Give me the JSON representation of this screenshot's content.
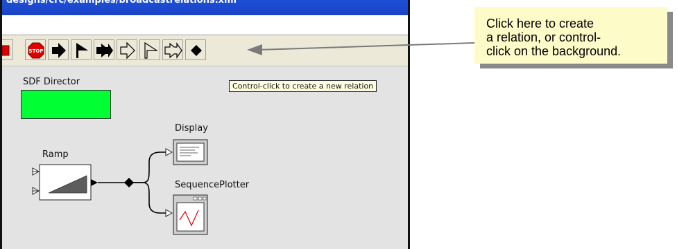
{
  "window": {
    "title": "designs/crc/examples/broadcastrelations.xml"
  },
  "toolbar": {
    "buttons": [
      {
        "name": "stop-red-button",
        "icon": "red-square-icon"
      },
      {
        "name": "stop-button",
        "icon": "stop-sign-icon",
        "text": "STOP"
      },
      {
        "name": "arrow-right-button",
        "icon": "arrow-right-icon"
      },
      {
        "name": "flag-button",
        "icon": "flag-icon"
      },
      {
        "name": "double-arrow-button",
        "icon": "double-arrow-icon"
      },
      {
        "name": "arrow-outline-button",
        "icon": "arrow-outline-icon"
      },
      {
        "name": "flag-outline-button",
        "icon": "flag-outline-icon"
      },
      {
        "name": "double-arrow-outline-button",
        "icon": "double-arrow-outline-icon"
      },
      {
        "name": "new-relation-button",
        "icon": "diamond-icon"
      }
    ]
  },
  "canvas": {
    "director_label": "SDF Director",
    "tooltip": "Control-click to create a new relation",
    "display_label": "Display",
    "ramp_label": "Ramp",
    "plotter_label": "SequencePlotter"
  },
  "callout": {
    "line1": "Click here to create",
    "line2": "a relation, or control-",
    "line3": "click on the background."
  },
  "colors": {
    "director": "#00ff33",
    "callout_bg": "#fdfbc8",
    "tooltip_bg": "#ffffe1",
    "titlebar": "#1d4fd6"
  }
}
